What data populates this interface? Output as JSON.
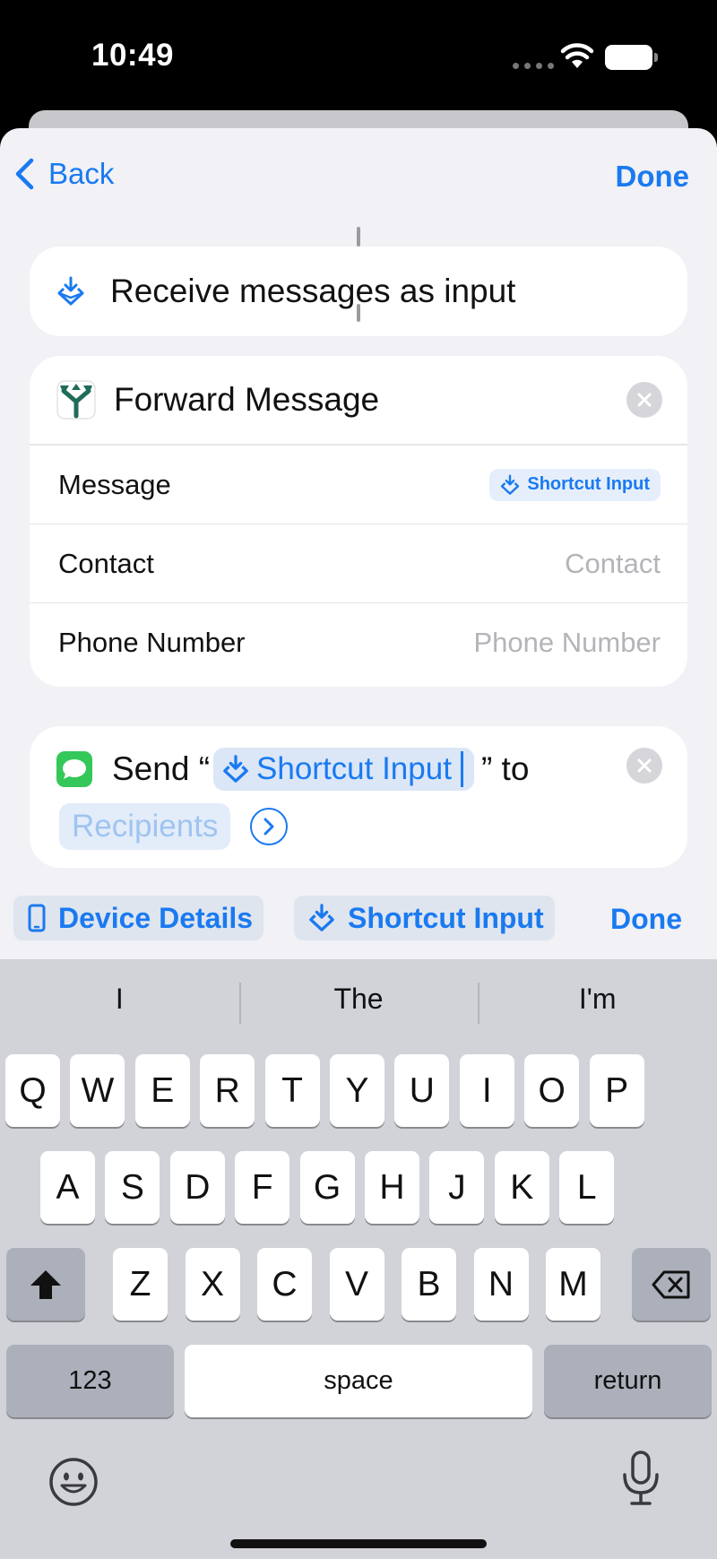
{
  "status_bar": {
    "time": "10:49"
  },
  "nav": {
    "back_label": "Back",
    "done_label": "Done"
  },
  "receive_card": {
    "title": "Receive messages as input",
    "icon": "shortcut-input-icon"
  },
  "forward_card": {
    "title": "Forward Message",
    "icon": "fork-arrow-icon",
    "rows": [
      {
        "label": "Message",
        "value": "Shortcut Input"
      },
      {
        "label": "Contact",
        "placeholder": "Contact"
      },
      {
        "label": "Phone Number",
        "placeholder": "Phone Number"
      }
    ]
  },
  "send_card": {
    "prefix": "Send “",
    "token": "Shortcut Input",
    "suffix": "” to",
    "recipients_placeholder": "Recipients",
    "icon": "messages-app-icon"
  },
  "toolbar": {
    "chip_device": "Device Details",
    "chip_shortcut": "Shortcut Input",
    "done_label": "Done"
  },
  "keyboard": {
    "predictions": [
      "I",
      "The",
      "I'm"
    ],
    "row1": [
      "Q",
      "W",
      "E",
      "R",
      "T",
      "Y",
      "U",
      "I",
      "O",
      "P"
    ],
    "row2": [
      "A",
      "S",
      "D",
      "F",
      "G",
      "H",
      "J",
      "K",
      "L"
    ],
    "row3": [
      "Z",
      "X",
      "C",
      "V",
      "B",
      "N",
      "M"
    ],
    "numbers_label": "123",
    "space_label": "space",
    "return_label": "return"
  },
  "colors": {
    "accent": "#1a7af0",
    "sheet_bg": "#f1f1f6",
    "keyboard_bg": "#d1d3d9"
  }
}
